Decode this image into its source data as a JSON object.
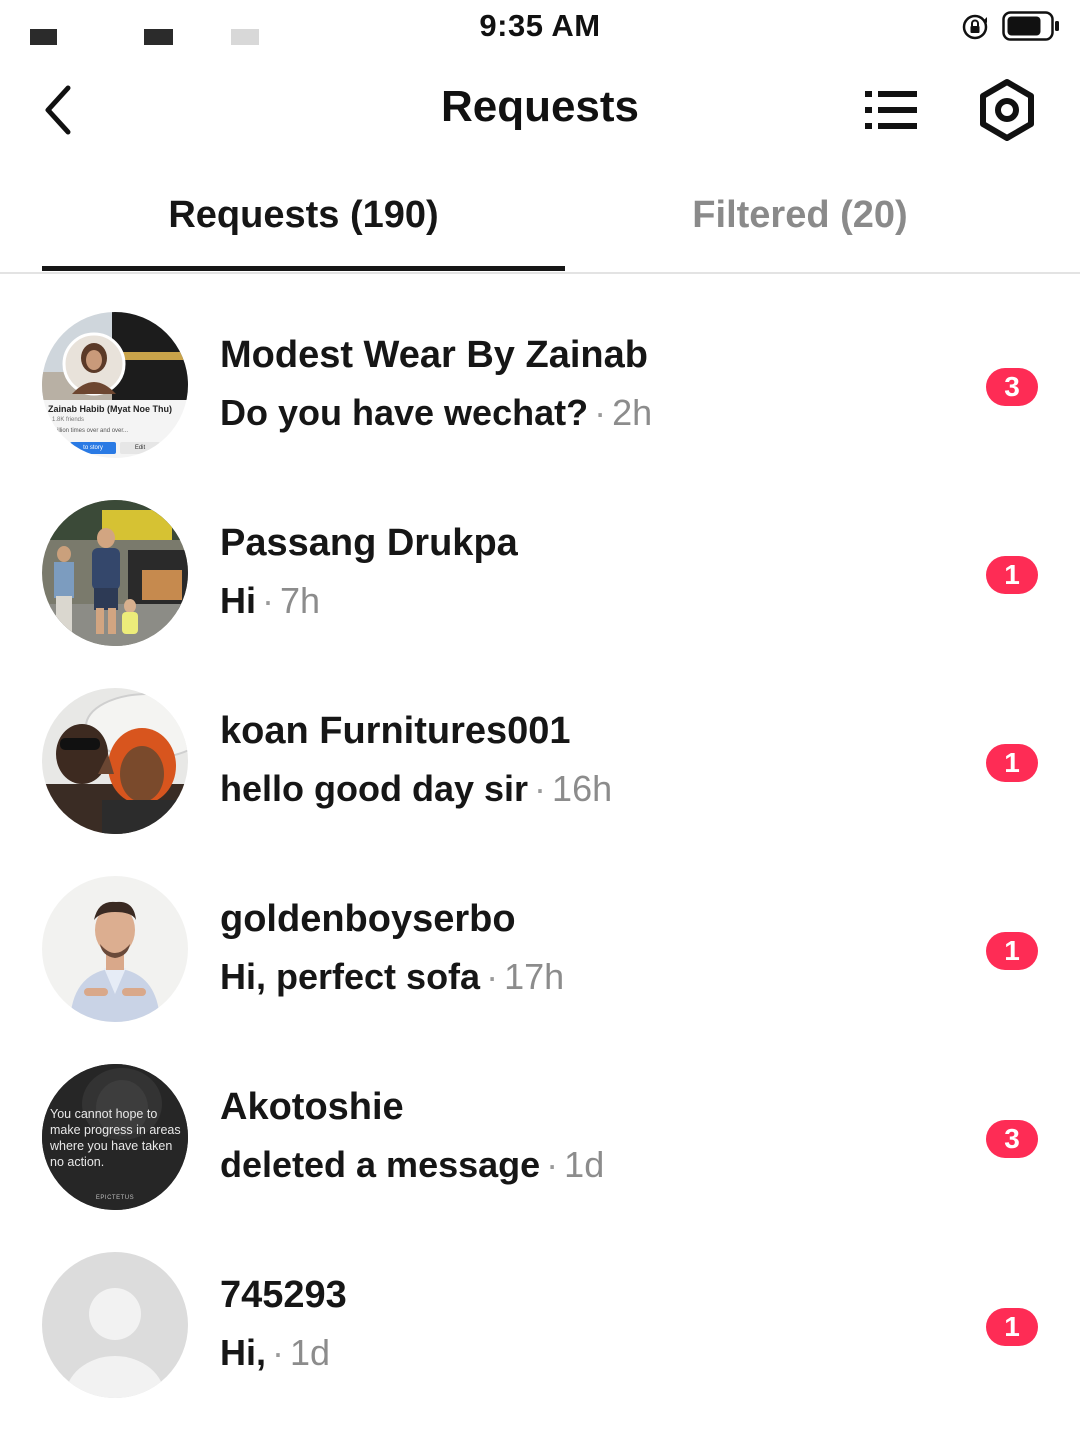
{
  "status_bar": {
    "time": "9:35 AM",
    "icons": [
      "signal-icon",
      "wifi-icon",
      "rotation-lock-icon",
      "battery-icon"
    ]
  },
  "header": {
    "title": "Requests",
    "back_icon": "chevron-left-icon",
    "list_icon": "list-icon",
    "settings_icon": "gear-icon"
  },
  "tabs": [
    {
      "label": "Requests (190)",
      "active": true
    },
    {
      "label": "Filtered (20)",
      "active": false
    }
  ],
  "requests": [
    {
      "name": "Modest Wear By Zainab",
      "message": "Do you have wechat?",
      "time": "2h",
      "unread": "3",
      "avatar_profile_name": "Zainab Habib (Myat Noe Thu)",
      "avatar_profile_sub": "1.8K friends",
      "avatar_profile_sub2": "...illion times over and over...",
      "avatar_story_label": "to story",
      "avatar_edit_label": "Edit"
    },
    {
      "name": "Passang Drukpa",
      "message": "Hi",
      "time": "7h",
      "unread": "1"
    },
    {
      "name": "koan Furnitures001",
      "message": "hello good day sir",
      "time": "16h",
      "unread": "1"
    },
    {
      "name": "goldenboyserbo",
      "message": "Hi, perfect sofa",
      "time": "17h",
      "unread": "1"
    },
    {
      "name": "Akotoshie",
      "message": "deleted a message",
      "time": "1d",
      "unread": "3",
      "avatar_quote": "You cannot hope to make progress in areas where you have taken no action.",
      "avatar_quote_author": "EPICTETUS"
    },
    {
      "name": "745293",
      "message": "Hi,",
      "time": "1d",
      "unread": "1"
    }
  ],
  "separator": "·",
  "colors": {
    "badge": "#fe2c55",
    "text_primary": "#161616",
    "text_secondary": "#8c8c8c",
    "tab_inactive": "#8a8a8a"
  }
}
